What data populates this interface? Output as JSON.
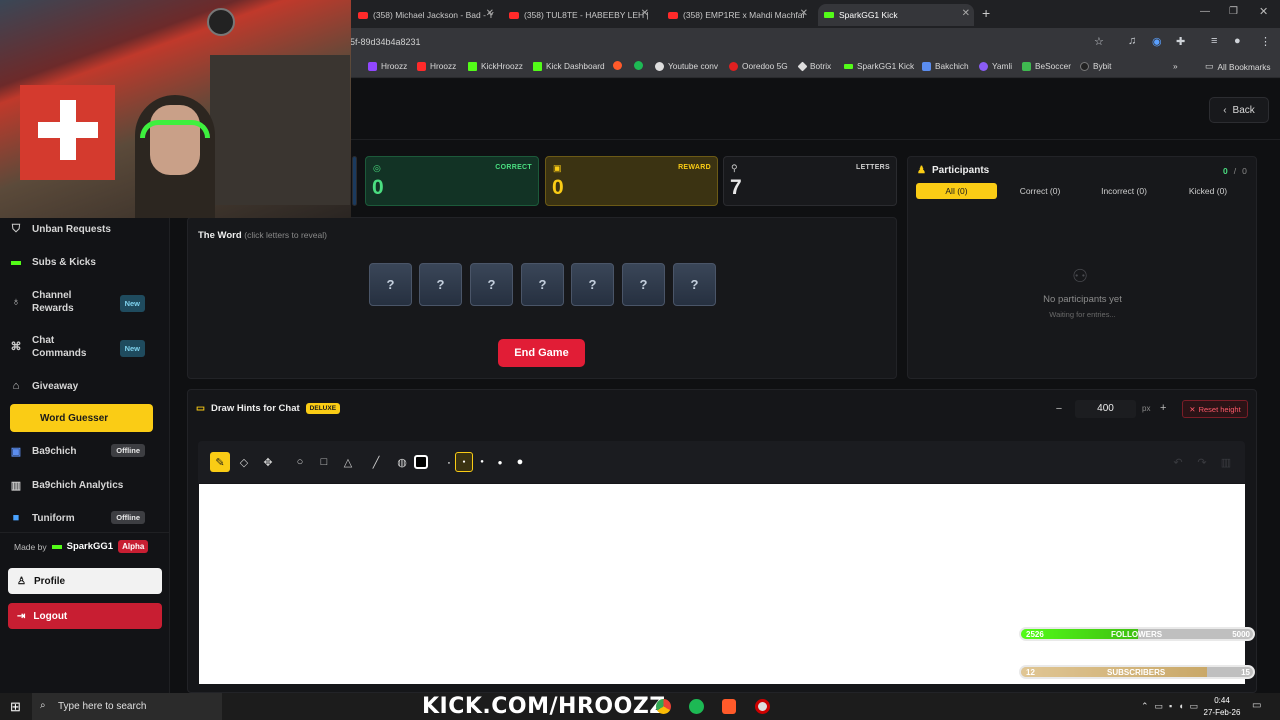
{
  "browser": {
    "tabs": [
      {
        "title": "(358) Michael Jackson - Bad - Y"
      },
      {
        "title": "(358) TUL8TE - HABEEBY LEH |"
      },
      {
        "title": "(358) EMP1RE x Mahdi Machfar"
      },
      {
        "title": "SparkGG1 Kick"
      }
    ],
    "url": "5f-89d34b4a8231",
    "bookmarks": [
      "Hroozz",
      "Hroozz",
      "KickHroozz",
      "Kick Dashboard",
      "Youtube conv",
      "Ooredoo 5G",
      "Botrix",
      "SparkGG1 Kick",
      "Bakchich",
      "Yamli",
      "BeSoccer",
      "Bybit"
    ],
    "all_bookmarks": "All Bookmarks"
  },
  "header": {
    "back_label": "Back"
  },
  "stats": {
    "correct": {
      "label": "CORRECT",
      "value": "0"
    },
    "reward": {
      "label": "REWARD",
      "value": "0"
    },
    "letters": {
      "label": "LETTERS",
      "value": "7"
    }
  },
  "word": {
    "title": "The Word",
    "hint": "(click letters to reveal)",
    "tiles": [
      "?",
      "?",
      "?",
      "?",
      "?",
      "?",
      "?"
    ],
    "end_game_label": "End Game"
  },
  "participants": {
    "title": "Participants",
    "count_a": "0",
    "sep": "/",
    "count_b": "0",
    "tabs": [
      "All (0)",
      "Correct (0)",
      "Incorrect (0)",
      "Kicked (0)"
    ],
    "empty_title": "No participants yet",
    "empty_sub": "Waiting for entries..."
  },
  "draw": {
    "title": "Draw Hints for Chat",
    "badge": "DELUXE",
    "height_value": "400",
    "unit": "px",
    "reset_label": "Reset height"
  },
  "sidebar": {
    "items": [
      {
        "label": "Unban Requests",
        "icon": "shield-icon"
      },
      {
        "label": "Subs & Kicks",
        "icon": "kick-icon"
      },
      {
        "label": "Channel Rewards",
        "icon": "medal-icon",
        "badge": "New"
      },
      {
        "label": "Chat Commands",
        "icon": "command-icon",
        "badge": "New"
      },
      {
        "label": "Giveaway",
        "icon": "gift-icon"
      },
      {
        "label": "Word Guesser",
        "icon": "gamepad-icon"
      },
      {
        "label": "Ba9chich",
        "icon": "ba9chich-icon",
        "badge": "Offline"
      },
      {
        "label": "Ba9chich Analytics",
        "icon": "analytics-icon"
      },
      {
        "label": "Tuniform",
        "icon": "tuniform-icon",
        "badge": "Offline"
      }
    ],
    "made_by": "Made by",
    "author": "SparkGG1",
    "alpha": "Alpha",
    "profile_label": "Profile",
    "logout_label": "Logout"
  },
  "overlays": {
    "followers": {
      "current": "2526",
      "label": "FOLLOWERS",
      "goal": "5000",
      "fraction": 0.505
    },
    "subscribers": {
      "current": "12",
      "label": "SUBSCRIBERS",
      "goal": "15",
      "fraction": 0.8
    },
    "stream_url": "KICK.COM/HROOZZ"
  },
  "taskbar": {
    "search_placeholder": "Type here to search",
    "time": "0:44",
    "date": "27-Feb-26"
  }
}
